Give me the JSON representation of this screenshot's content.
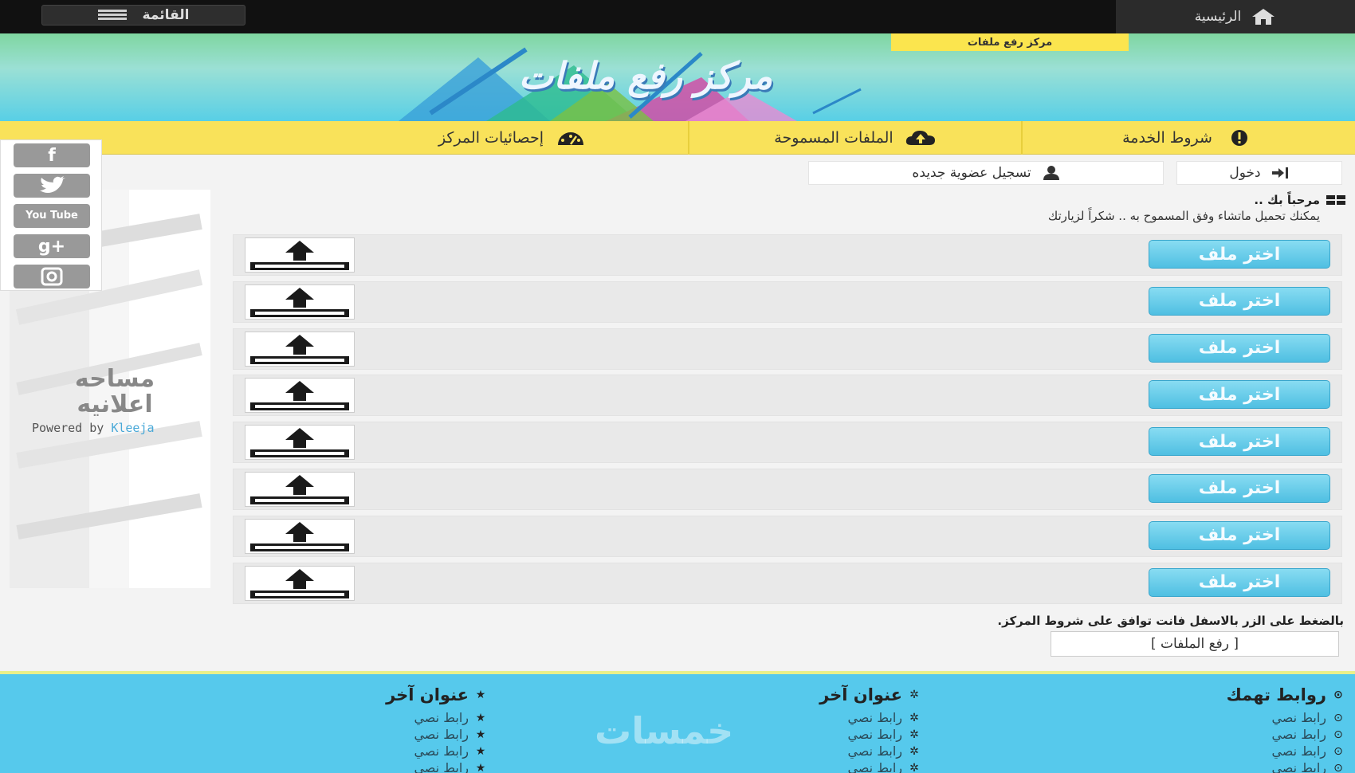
{
  "topbar": {
    "menu_label": "القائمة",
    "home_label": "الرئيسية"
  },
  "banner": {
    "title": "مركز رفع ملفات",
    "tag": "مركز رفع ملفات"
  },
  "nav": {
    "items": [
      {
        "label": "شروط الخدمة",
        "icon": "exclamation-icon"
      },
      {
        "label": "الملفات المسموحة",
        "icon": "cloud-upload-icon"
      },
      {
        "label": "إحصائيات المركز",
        "icon": "gauge-icon"
      }
    ]
  },
  "social": [
    "facebook-icon",
    "twitter-icon",
    "youtube-icon",
    "google-plus-icon",
    "instagram-icon"
  ],
  "social_youtube_text": "You Tube",
  "ad": {
    "label_line1": "مساحه",
    "label_line2": "اعلانيه",
    "powered_prefix": "Powered by",
    "powered_brand": "Kleeja"
  },
  "account": {
    "login_label": "دخول",
    "register_label": "تسجيل عضوية جديده"
  },
  "welcome": {
    "title": "مرحباً بك ..",
    "text": "يمكنك تحميل ماتشاء وفق المسموح به .. شكراً لزيارتك"
  },
  "upload": {
    "choose_label": "اختر ملف",
    "rows": 8
  },
  "terms_note": "بالضغط على الزر بالاسفل فانت توافق على شروط المركز.",
  "submit_label": "[ رفع الملفات ]",
  "footer": {
    "col1": {
      "title": "روابط تهمك",
      "links": [
        "رابط نصي",
        "رابط نصي",
        "رابط نصي",
        "رابط نصي"
      ]
    },
    "col2": {
      "title": "عنوان آخر",
      "links": [
        "رابط نصي",
        "رابط نصي",
        "رابط نصي",
        "رابط نصي"
      ]
    },
    "col3": {
      "title": "عنوان آخر",
      "links": [
        "رابط نصي",
        "رابط نصي",
        "رابط نصي",
        "رابط نصي"
      ]
    },
    "watermark": "خمسات"
  },
  "colors": {
    "accent_yellow": "#f9e25a",
    "button_blue": "#4fbfe2",
    "footer_blue": "#56c9ec"
  }
}
